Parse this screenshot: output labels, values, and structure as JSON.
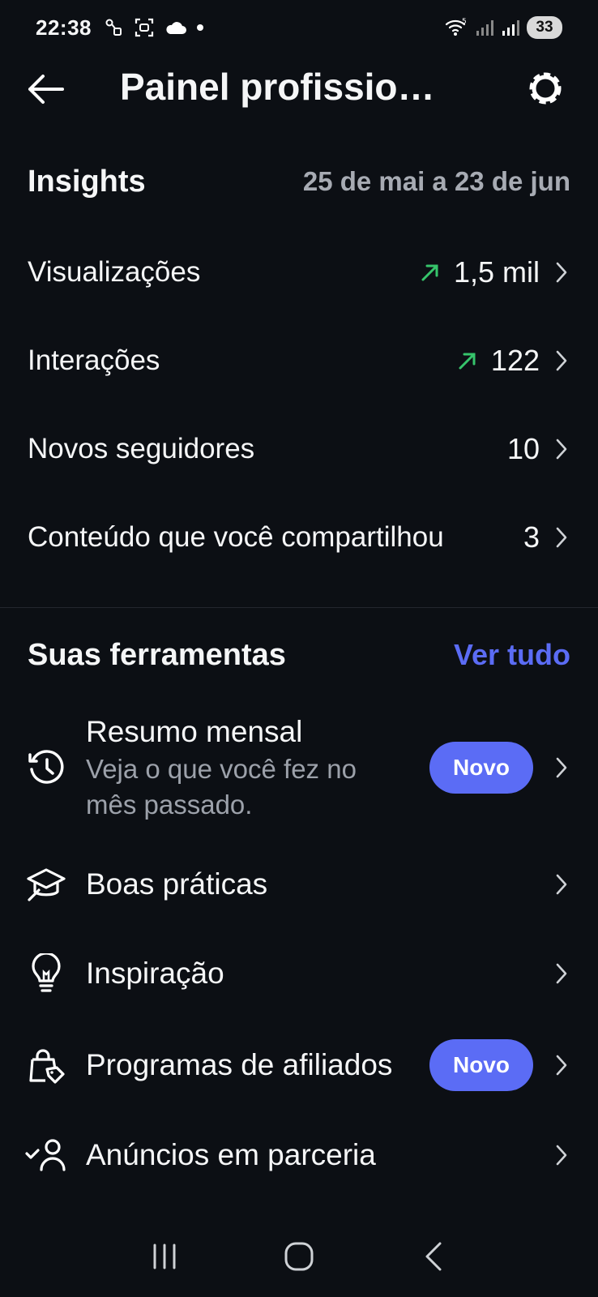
{
  "status_bar": {
    "time": "22:38",
    "battery": "33"
  },
  "header": {
    "title": "Painel profissio…"
  },
  "insights": {
    "title": "Insights",
    "date_range": "25 de mai a 23 de jun",
    "metrics": [
      {
        "label": "Visualizações",
        "value": "1,5 mil",
        "trend": "up"
      },
      {
        "label": "Interações",
        "value": "122",
        "trend": "up"
      },
      {
        "label": "Novos seguidores",
        "value": "10"
      },
      {
        "label": "Conteúdo que você compartilhou",
        "value": "3"
      }
    ]
  },
  "tools": {
    "title": "Suas ferramentas",
    "see_all": "Ver tudo",
    "items": [
      {
        "title": "Resumo mensal",
        "subtitle": "Veja o que você fez no mês passado.",
        "badge": "Novo",
        "icon": "history-icon"
      },
      {
        "title": "Boas práticas",
        "icon": "graduation-cap-icon"
      },
      {
        "title": "Inspiração",
        "icon": "lightbulb-icon"
      },
      {
        "title": "Programas de afiliados",
        "badge": "Novo",
        "icon": "shopping-bag-tag-icon"
      },
      {
        "title": "Anúncios em parceria",
        "icon": "person-check-icon"
      }
    ]
  },
  "colors": {
    "background": "#0c0f14",
    "accent": "#5b6cf5",
    "trend_up": "#36c46b",
    "muted": "#a7abb3"
  }
}
